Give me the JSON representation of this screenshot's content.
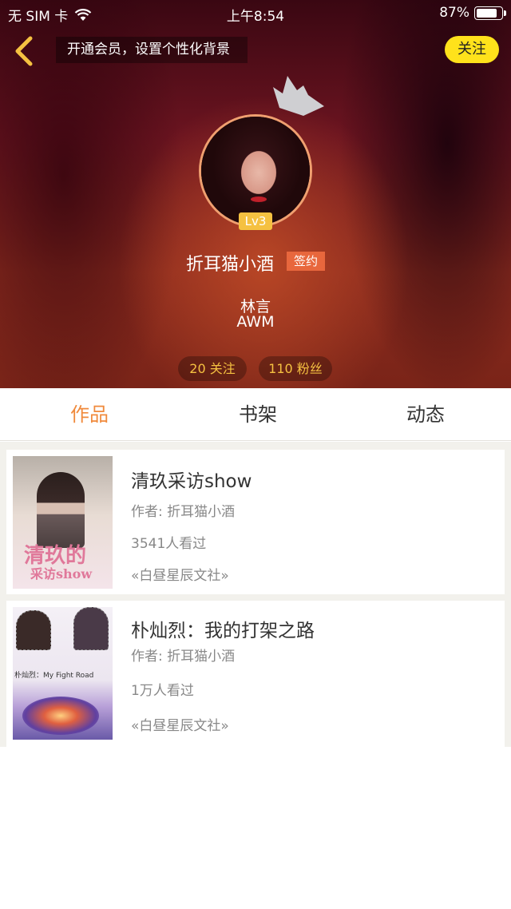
{
  "status_bar": {
    "carrier": "无 SIM 卡",
    "time": "上午8:54",
    "battery": "87%",
    "battery_level": 0.87
  },
  "header": {
    "vip_banner": "开通会员，设置个性化背景",
    "follow_label": "关注"
  },
  "profile": {
    "level": "Lv3",
    "name": "折耳猫小酒",
    "signed_badge": "签约",
    "bio_line1": "林言",
    "bio_line2": "AWM",
    "following": "20 关注",
    "followers": "110 粉丝"
  },
  "tabs": [
    {
      "label": "作品",
      "active": true
    },
    {
      "label": "书架",
      "active": false
    },
    {
      "label": "动态",
      "active": false
    }
  ],
  "books": [
    {
      "title": "清玖采访show",
      "author": "作者: 折耳猫小酒",
      "views": "3541人看过",
      "publisher": "«白昼星辰文社»",
      "cover_text_1": "清玖的",
      "cover_text_2": "采访show"
    },
    {
      "title": "朴灿烈：我的打架之路",
      "author": "作者: 折耳猫小酒",
      "views": "1万人看过",
      "publisher": "«白昼星辰文社»",
      "cover_text_1": "朴灿烈：My Fight Road"
    }
  ],
  "colors": {
    "accent": "#f08a3c",
    "follow_button": "#ffe21b",
    "level_badge": "#f5c141",
    "signed_badge": "#e8673d"
  }
}
